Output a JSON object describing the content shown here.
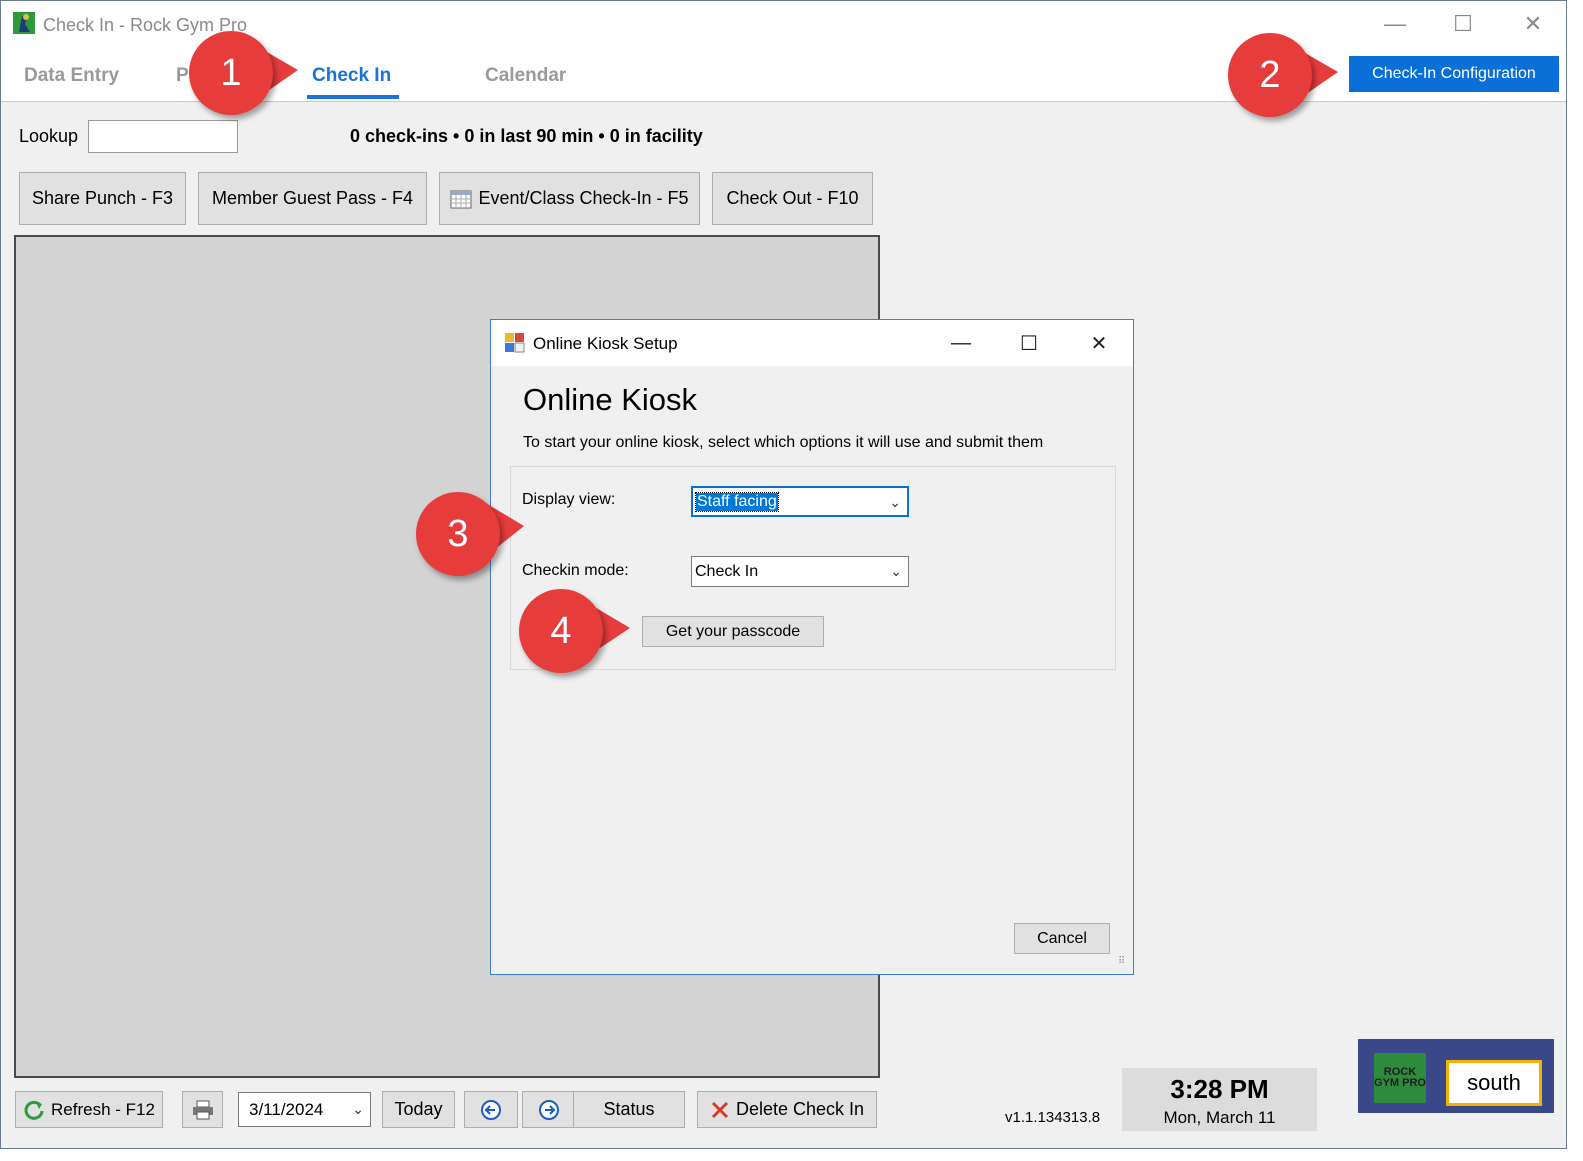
{
  "window": {
    "title": "Check In - Rock Gym Pro",
    "controls": {
      "minimize": "—",
      "maximize": "☐",
      "close": "✕"
    }
  },
  "tabs": [
    {
      "label": "Data Entry",
      "active": false
    },
    {
      "label": "P",
      "active": false
    },
    {
      "label": "Check In",
      "active": true
    },
    {
      "label": "Calendar",
      "active": false
    }
  ],
  "config_button": "Check-In Configuration",
  "lookup": {
    "label": "Lookup",
    "value": ""
  },
  "stats": "0 check-ins • 0 in last 90 min • 0 in facility",
  "action_buttons": {
    "share_punch": "Share Punch - F3",
    "guest_pass": "Member Guest Pass - F4",
    "event_checkin": "Event/Class Check-In - F5",
    "check_out": "Check Out - F10"
  },
  "dialog": {
    "title": "Online Kiosk Setup",
    "heading": "Online Kiosk",
    "subtitle": "To start your online kiosk, select which options it will use and submit them",
    "display_view": {
      "label": "Display view:",
      "value": "Staff facing"
    },
    "checkin_mode": {
      "label": "Checkin mode:",
      "value": "Check In"
    },
    "passcode_button": "Get your passcode",
    "cancel_button": "Cancel",
    "controls": {
      "minimize": "—",
      "maximize": "☐",
      "close": "✕"
    }
  },
  "bottom_bar": {
    "refresh": "Refresh - F12",
    "date": "3/11/2024",
    "today": "Today",
    "prev": "←",
    "next": "→",
    "status": "Status",
    "delete": "Delete Check In"
  },
  "version": "v1.1.134313.8",
  "clock": {
    "time": "3:28 PM",
    "date": "Mon, March 11"
  },
  "location": {
    "logo_text": "ROCK GYM PRO",
    "name": "south"
  },
  "callouts": [
    "1",
    "2",
    "3",
    "4"
  ],
  "colors": {
    "accent": "#1a73d9",
    "callout": "#e63c3c",
    "logo_bg": "#3a4789",
    "location_border": "#f0b400"
  },
  "icons": [
    "app-icon",
    "calendar-icon",
    "refresh-icon",
    "printer-icon",
    "arrow-left-icon",
    "arrow-right-icon",
    "delete-x-icon",
    "dialog-app-icon",
    "chevron-down-icon"
  ]
}
